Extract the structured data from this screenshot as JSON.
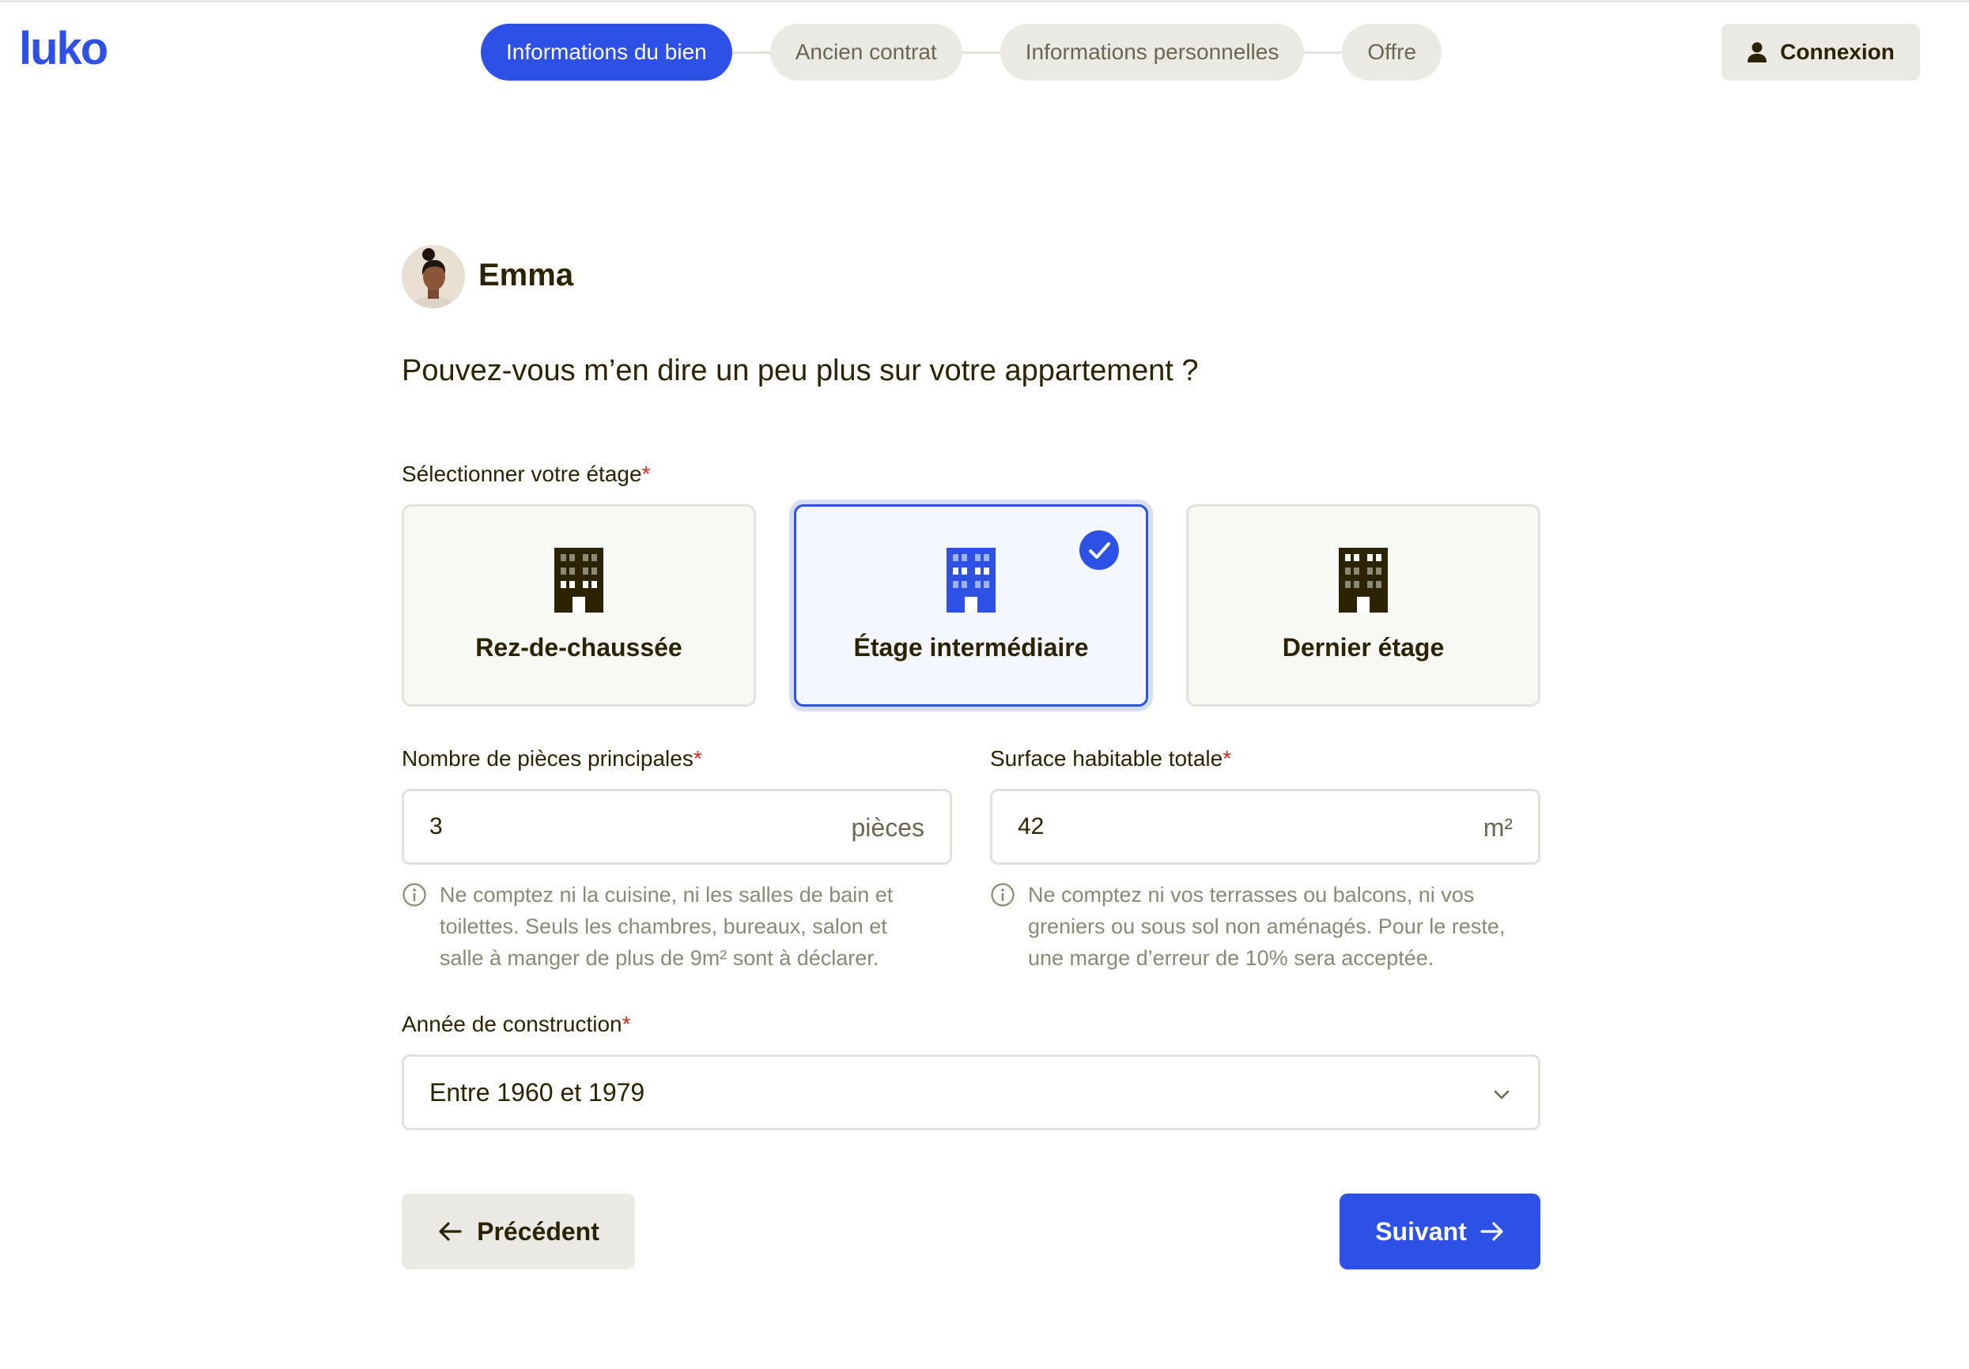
{
  "brand": {
    "logo_text": "luko",
    "color": "#2d50e6"
  },
  "stepper": {
    "steps": [
      {
        "label": "Informations du bien",
        "active": true
      },
      {
        "label": "Ancien contrat",
        "active": false
      },
      {
        "label": "Informations personnelles",
        "active": false
      },
      {
        "label": "Offre",
        "active": false
      }
    ]
  },
  "header": {
    "login_label": "Connexion",
    "login_icon": "user-icon"
  },
  "agent": {
    "name": "Emma",
    "avatar": "agent-avatar"
  },
  "question": "Pouvez-vous m’en dire un peu plus sur votre appartement ?",
  "floor": {
    "label": "Sélectionner votre étage",
    "required_mark": "*",
    "options": [
      {
        "label": "Rez-de-chaussée",
        "icon": "building-icon",
        "selected": false
      },
      {
        "label": "Étage intermédiaire",
        "icon": "building-icon",
        "selected": true
      },
      {
        "label": "Dernier étage",
        "icon": "building-icon",
        "selected": false
      }
    ]
  },
  "rooms": {
    "label": "Nombre de pièces principales",
    "required_mark": "*",
    "value": "3",
    "unit": "pièces",
    "hint": "Ne comptez ni la cuisine, ni les salles de bain et toilettes. Seuls les chambres, bureaux, salon et salle à manger de plus de 9m² sont à déclarer."
  },
  "surface": {
    "label": "Surface habitable totale",
    "required_mark": "*",
    "value": "42",
    "unit": "m²",
    "hint": "Ne comptez ni vos terrasses ou balcons, ni vos greniers ou sous sol non aménagés. Pour le reste, une marge d’erreur de 10% sera acceptée."
  },
  "construction": {
    "label": "Année de construction",
    "required_mark": "*",
    "value": "Entre 1960 et 1979"
  },
  "nav": {
    "prev_label": "Précédent",
    "next_label": "Suivant"
  },
  "colors": {
    "accent": "#2d50e6",
    "text": "#2c2302",
    "muted": "#8c8878",
    "required": "#d52b1e",
    "step_bg": "#eae9e3"
  }
}
